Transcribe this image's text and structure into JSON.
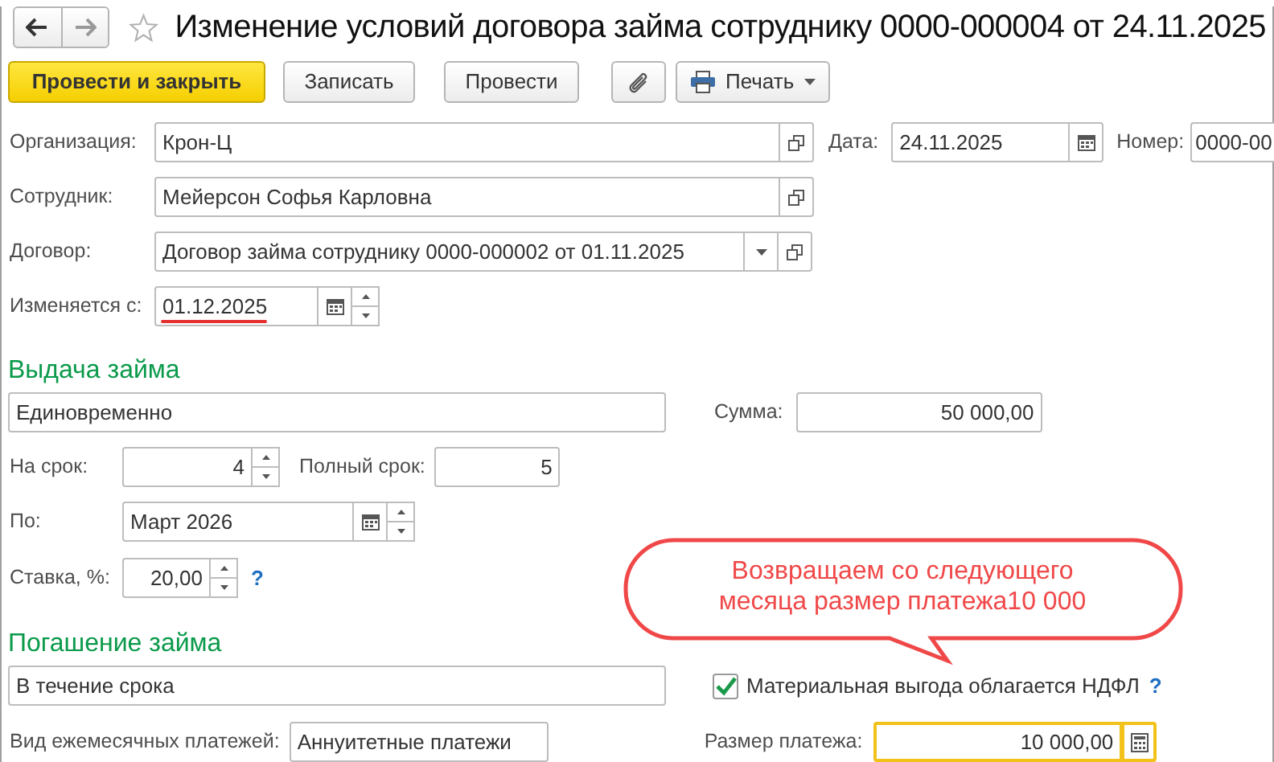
{
  "window": {
    "title": "Изменение условий договора займа сотруднику 0000-000004 от 24.11.2025",
    "favorite": false
  },
  "toolbar": [
    {
      "kind": "primary",
      "label": "Провести и закрыть"
    },
    {
      "kind": "default",
      "label": "Записать"
    },
    {
      "kind": "default",
      "label": "Провести"
    },
    {
      "kind": "attach"
    },
    {
      "kind": "menu",
      "label": "Печать"
    }
  ],
  "header": {
    "organization": {
      "label": "Организация:",
      "value": "Крон-Ц"
    },
    "date": {
      "label": "Дата:",
      "value": "24.11.2025"
    },
    "number": {
      "label": "Номер:",
      "value": "0000-00"
    },
    "employee": {
      "label": "Сотрудник:",
      "value": "Мейерсон Софья Карловна"
    },
    "contract": {
      "label": "Договор:",
      "value": "Договор займа сотруднику 0000-000002 от 01.11.2025"
    },
    "change_from": {
      "label": "Изменяется с:",
      "value": "01.12.2025",
      "underlined": true
    }
  },
  "issue": {
    "heading": "Выдача займа",
    "method": "Единовременно",
    "sum": {
      "label": "Сумма:",
      "value": "50 000,00"
    },
    "term": {
      "label": "На срок:",
      "value": "4"
    },
    "full_term": {
      "label": "Полный срок:",
      "value": "5"
    },
    "until": {
      "label": "По:",
      "value": "Март 2026"
    },
    "rate": {
      "label": "Ставка, %:",
      "value": "20,00",
      "help": "?"
    }
  },
  "repayment": {
    "heading": "Погашение займа",
    "method": "В течение срока",
    "ndfl": {
      "label": "Материальная выгода облагается НДФЛ",
      "checked": true,
      "help": "?"
    },
    "payment_type": {
      "label": "Вид ежемесячных платежей:",
      "value": "Аннуитетные платежи"
    },
    "payment_size": {
      "label": "Размер платежа:",
      "value": "10 000,00",
      "focused": true
    }
  },
  "callout": {
    "text": "Возвращаем со следующего\nмесяца размер платежа10 000"
  }
}
